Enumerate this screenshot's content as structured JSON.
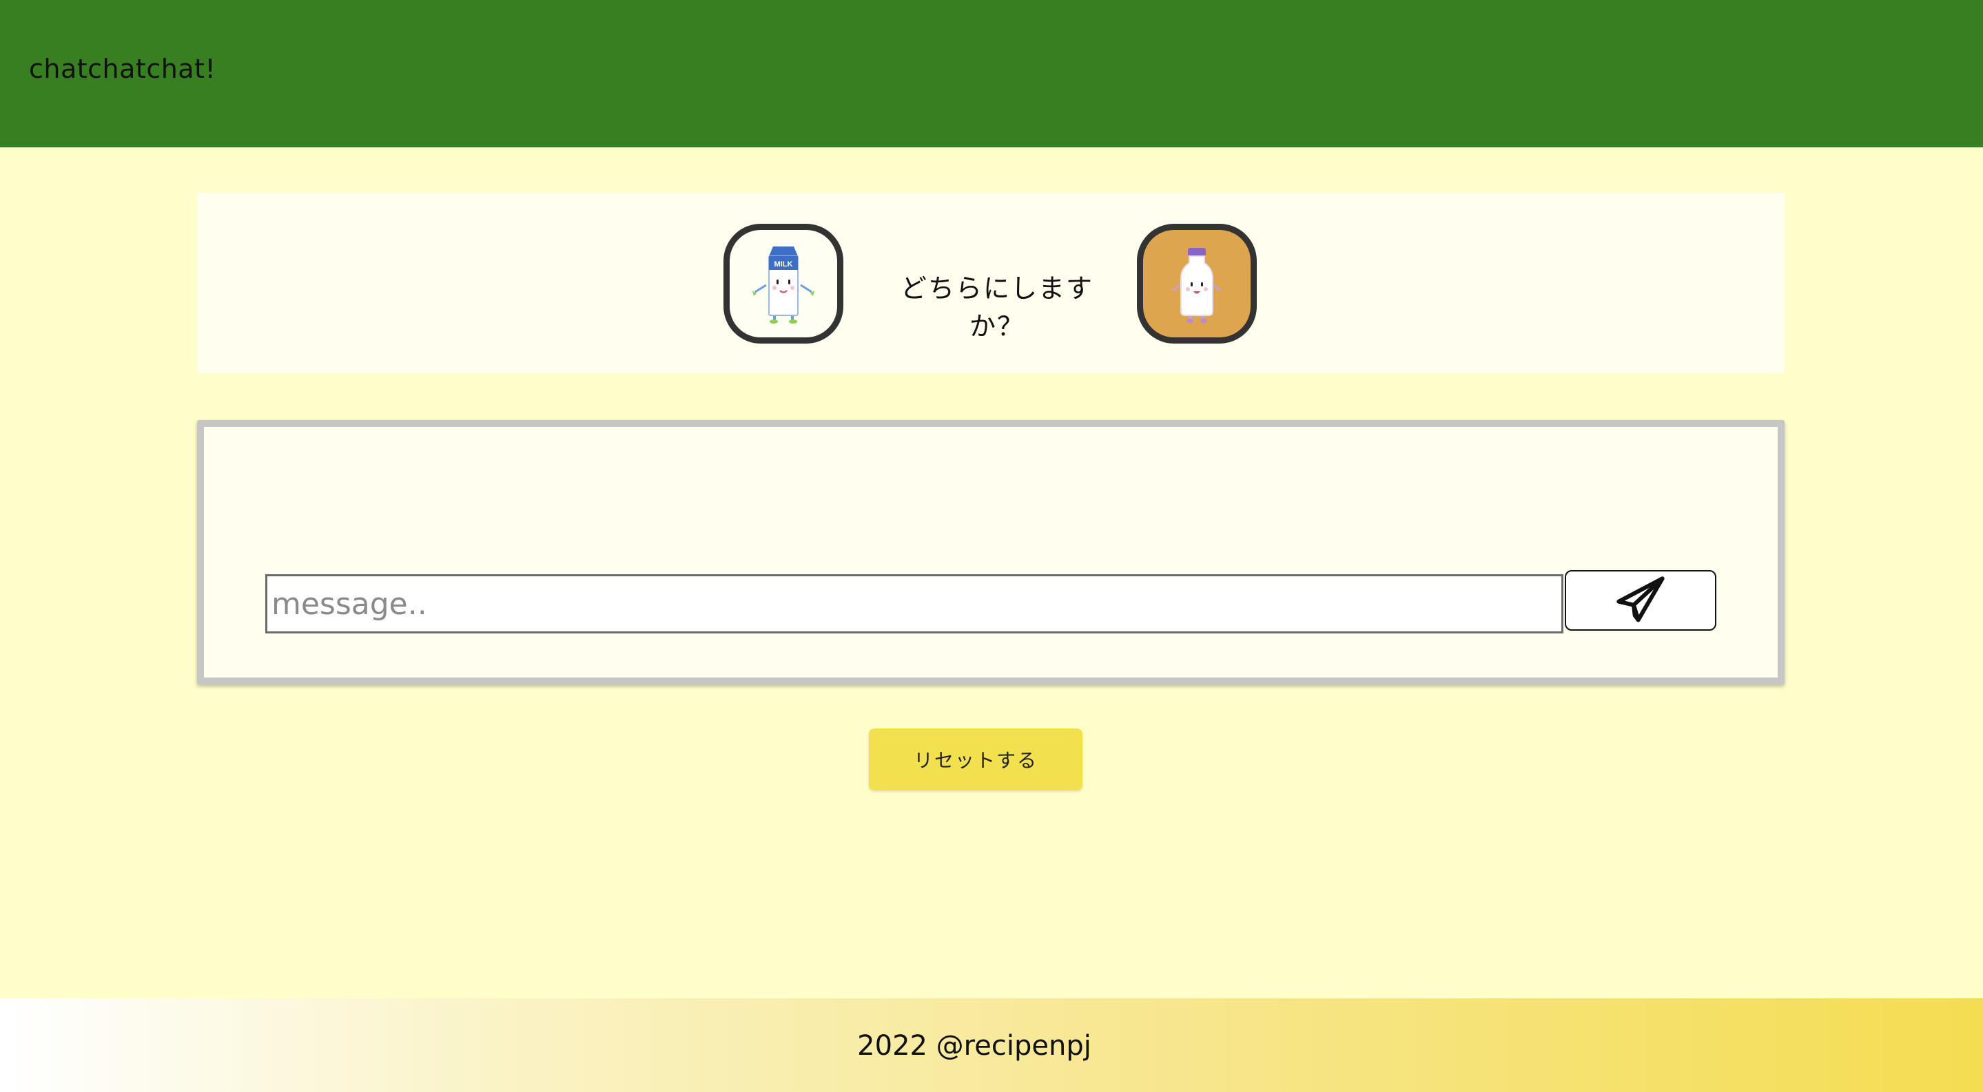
{
  "header": {
    "title": "chatchatchat!",
    "background": "#387f22"
  },
  "choice": {
    "prompt": "どちらにしますか？",
    "options": [
      {
        "name": "milk-carton",
        "icon": "milk-carton-character-icon",
        "label": "MILK",
        "selected": false
      },
      {
        "name": "milk-bottle",
        "icon": "milk-bottle-character-icon",
        "selected": true
      }
    ]
  },
  "chat": {
    "input_placeholder": "message..",
    "input_value": "",
    "send_icon": "paper-plane-icon"
  },
  "actions": {
    "reset_label": "リセットする"
  },
  "footer": {
    "text": "2022 @recipenpj"
  },
  "colors": {
    "page_background": "#fffdc9",
    "panel_background": "#fffeef",
    "accent_yellow": "#f3e04f",
    "selected_avatar": "#dca54e"
  }
}
